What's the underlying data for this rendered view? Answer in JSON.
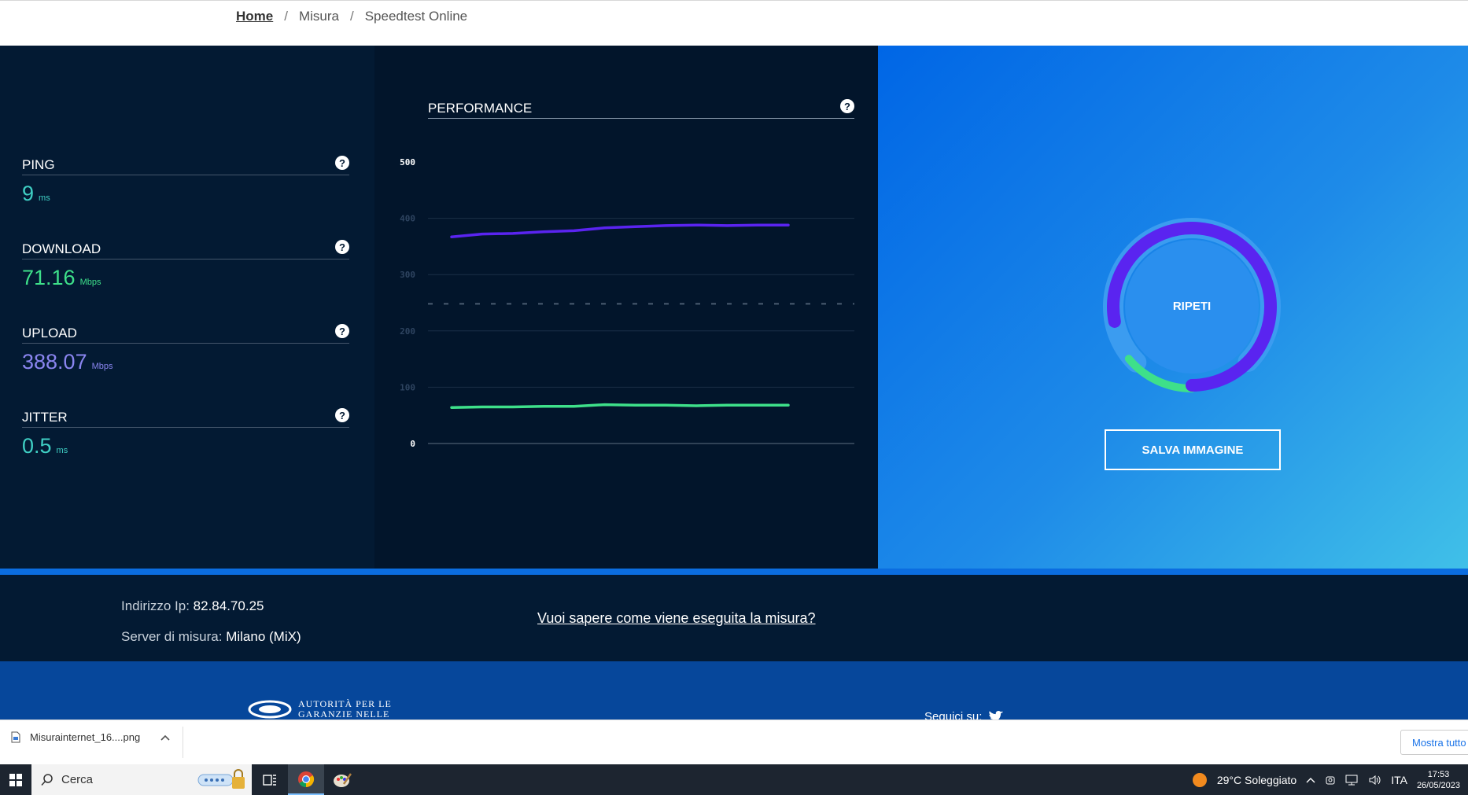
{
  "breadcrumb": {
    "home": "Home",
    "sep": "/",
    "misura": "Misura",
    "current": "Speedtest Online"
  },
  "metrics": {
    "ping": {
      "label": "PING",
      "value": "9",
      "unit": "ms",
      "help": "?"
    },
    "download": {
      "label": "DOWNLOAD",
      "value": "71.16",
      "unit": "Mbps",
      "help": "?"
    },
    "upload": {
      "label": "UPLOAD",
      "value": "388.07",
      "unit": "Mbps",
      "help": "?"
    },
    "jitter": {
      "label": "JITTER",
      "value": "0.5",
      "unit": "ms",
      "help": "?"
    }
  },
  "performance": {
    "title": "PERFORMANCE",
    "help": "?"
  },
  "chart_data": {
    "type": "line",
    "title": "PERFORMANCE",
    "y_ticks": [
      "500",
      "400",
      "300",
      "200",
      "100",
      "0"
    ],
    "ylim": [
      0,
      500
    ],
    "x": [
      0,
      1,
      2,
      3,
      4,
      5,
      6,
      7,
      8,
      9,
      10,
      11
    ],
    "series": [
      {
        "color": "#5a24f0",
        "values": [
          367,
          372,
          373,
          376,
          378,
          383,
          385,
          387,
          388,
          387,
          388,
          388
        ]
      },
      {
        "color": "#3ee08a",
        "values": [
          64,
          65,
          65,
          66,
          66,
          69,
          68,
          68,
          67,
          68,
          68,
          68
        ]
      }
    ],
    "dashed_reference": 248,
    "grid": true
  },
  "gauge": {
    "button_label": "RIPETI",
    "upload_fraction": 0.78,
    "download_fraction": 0.14
  },
  "save_button": "SALVA IMMAGINE",
  "info": {
    "ip_label": "Indirizzo Ip:",
    "ip_value": "82.84.70.25",
    "server_label": "Server di misura:",
    "server_value": "Milano (MiX)",
    "how_link": "Vuoi sapere come viene eseguita la misura?"
  },
  "footer": {
    "agcom_line1": "AUTORITÀ PER LE",
    "agcom_line2": "GARANZIE NELLE",
    "seguici": "Seguici su:"
  },
  "downloads": {
    "file": "Misurainternet_16....png",
    "show_all": "Mostra tutto"
  },
  "taskbar": {
    "search": "Cerca",
    "weather": "29°C  Soleggiato",
    "lang": "ITA",
    "time": "17:53",
    "date": "26/05/2023"
  },
  "colors": {
    "upload": "#5a24f0",
    "download": "#3ee08a",
    "panel": "#031a33",
    "accent": "#0b6de0"
  }
}
